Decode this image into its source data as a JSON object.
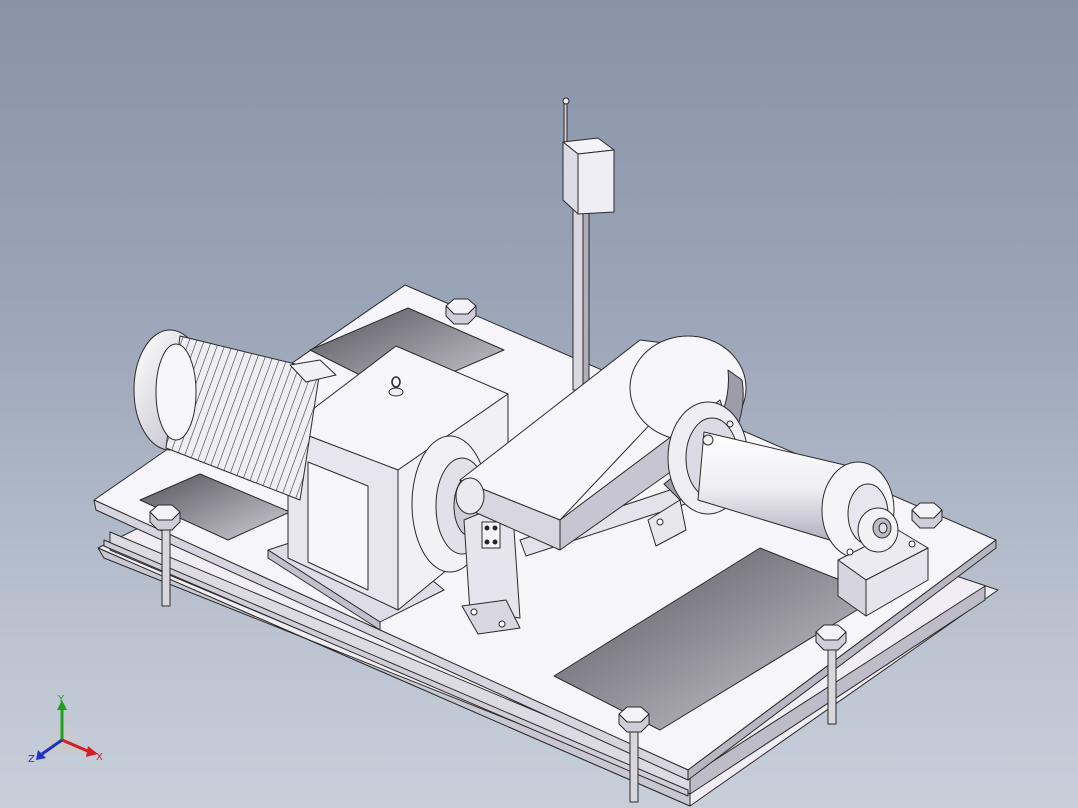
{
  "viewport": {
    "background_top": "#8893a8",
    "background_bottom": "#c8cfdb",
    "part_color": "#f3f1f6",
    "edge_color": "#2b2b2b",
    "shadow_color": "#9a99a6"
  },
  "triad": {
    "x_label": "X",
    "y_label": "Y",
    "z_label": "Z",
    "x_color": "#d02020",
    "y_color": "#20a020",
    "z_color": "#2030c0"
  }
}
